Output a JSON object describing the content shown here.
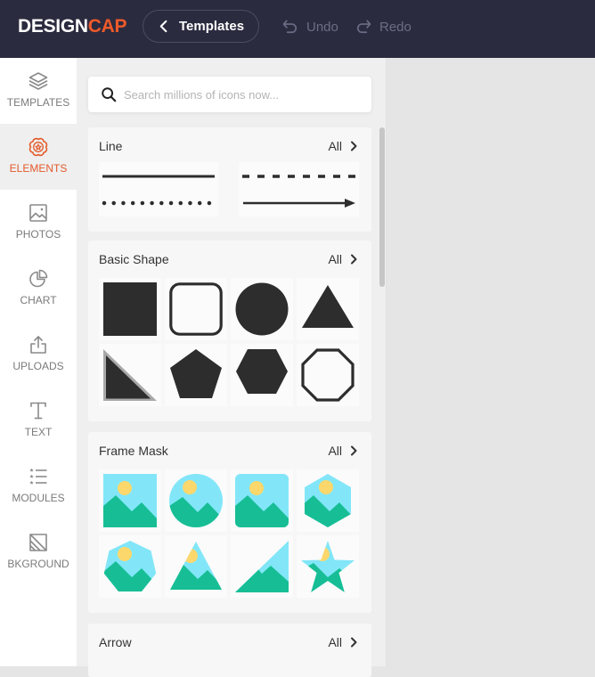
{
  "app": {
    "logo_main": "DESIGN",
    "logo_accent": "CAP"
  },
  "header": {
    "back_button_label": "Templates",
    "undo_label": "Undo",
    "redo_label": "Redo"
  },
  "sidebar": {
    "active": "ELEMENTS",
    "items": [
      {
        "label": "TEMPLATES",
        "icon": "layers-icon"
      },
      {
        "label": "ELEMENTS",
        "icon": "badge-star-icon"
      },
      {
        "label": "PHOTOS",
        "icon": "image-icon"
      },
      {
        "label": "CHART",
        "icon": "pie-chart-icon"
      },
      {
        "label": "UPLOADS",
        "icon": "upload-icon"
      },
      {
        "label": "TEXT",
        "icon": "text-icon"
      },
      {
        "label": "MODULES",
        "icon": "star-list-icon"
      },
      {
        "label": "BKGROUND",
        "icon": "background-icon"
      }
    ]
  },
  "panel": {
    "search": {
      "placeholder": "Search millions of icons now...",
      "value": ""
    },
    "sections": [
      {
        "title": "Line",
        "all_label": "All",
        "items": [
          "solid-line",
          "dashed-line",
          "dotted-line",
          "arrow-line"
        ]
      },
      {
        "title": "Basic Shape",
        "all_label": "All",
        "items": [
          "square",
          "rounded-square-outline",
          "circle",
          "triangle",
          "right-triangle",
          "pentagon",
          "hexagon",
          "octagon-outline"
        ]
      },
      {
        "title": "Frame Mask",
        "all_label": "All",
        "items": [
          "square-frame",
          "circle-frame",
          "rounded-square-frame",
          "hexagon-frame",
          "heptagon-frame",
          "triangle-frame",
          "right-triangle-frame",
          "star-frame"
        ]
      },
      {
        "title": "Arrow",
        "all_label": "All",
        "items": []
      }
    ]
  },
  "colors": {
    "header_bg": "#2b2b3f",
    "accent": "#ee5a2a",
    "shape_fill": "#2d2d2d",
    "frame_sky": "#82e6f8",
    "frame_sun": "#fcd76b",
    "frame_mountain": "#17be95",
    "canvas_bg": "#e5e5e5"
  }
}
